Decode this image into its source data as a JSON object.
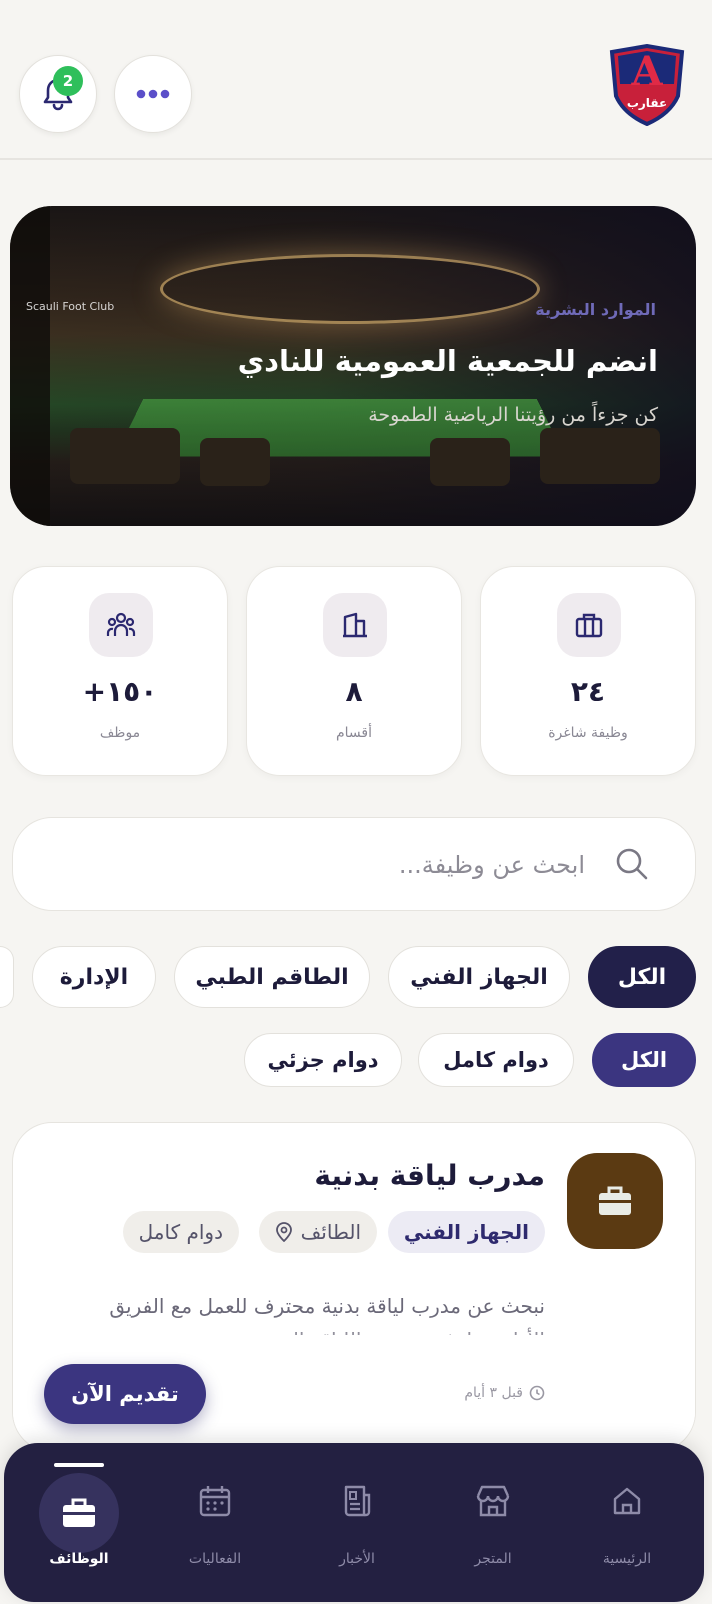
{
  "header": {
    "notification_count": "2",
    "club_logo_text": "A",
    "club_logo_caption": "عقارب"
  },
  "hero": {
    "tag": "الموارد البشرية",
    "title": "انضم للجمعية العمومية للنادي",
    "subtitle": "كن جزءاً من رؤيتنا الرياضية الطموحة",
    "stadium_sign": "Scauli Foot Club"
  },
  "stats": [
    {
      "value": "٢٤",
      "label": "وظيفة شاغرة",
      "icon": "briefcase-icon"
    },
    {
      "value": "٨",
      "label": "أقسام",
      "icon": "building-icon"
    },
    {
      "value": "+١٥٠",
      "label": "موظف",
      "icon": "people-icon"
    }
  ],
  "search": {
    "placeholder": "ابحث عن وظيفة..."
  },
  "department_filters": [
    "الكل",
    "الجهاز الفني",
    "الطاقم الطبي",
    "الإدارة"
  ],
  "type_filters": [
    "الكل",
    "دوام كامل",
    "دوام جزئي"
  ],
  "job": {
    "title": "مدرب لياقة بدنية",
    "department": "الجهاز الفني",
    "location": "الطائف",
    "type": "دوام كامل",
    "description": "نبحث عن مدرب لياقة بدنية محترف للعمل مع الفريق الأول ... لرفع مستوى اللياقة البدنية",
    "posted": "قبل ٣ أيام",
    "apply_label": "تقديم الآن"
  },
  "nav": [
    {
      "label": "الرئيسية",
      "icon": "home-icon"
    },
    {
      "label": "المتجر",
      "icon": "store-icon"
    },
    {
      "label": "الأخبار",
      "icon": "news-icon"
    },
    {
      "label": "الفعاليات",
      "icon": "calendar-icon"
    },
    {
      "label": "الوظائف",
      "icon": "briefcase-icon",
      "active": true
    }
  ],
  "colors": {
    "primary": "#22204a",
    "accent": "#3b3580",
    "badge": "#2fbf5b",
    "background": "#f6f5f2"
  }
}
